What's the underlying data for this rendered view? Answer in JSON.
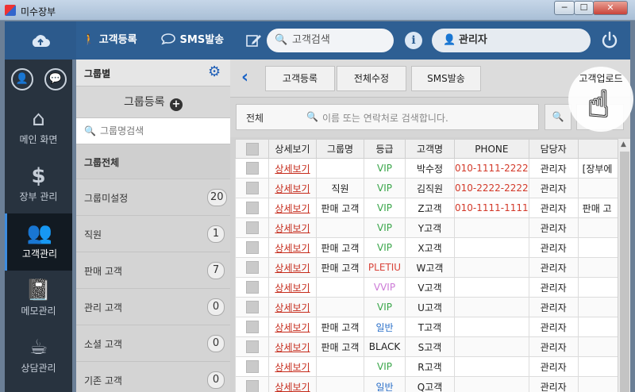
{
  "window": {
    "title": "미수장부",
    "min": "─",
    "max": "☐",
    "close": "✕"
  },
  "topbar": {
    "customer_register": "고객등록",
    "sms_send": "SMS발송",
    "search_placeholder": "고객검색",
    "user_name": "관리자"
  },
  "leftnav": {
    "items": [
      {
        "label": "메인 화면",
        "icon": "home-icon"
      },
      {
        "label": "장부 관리",
        "icon": "dollar-icon"
      },
      {
        "label": "고객관리",
        "icon": "users-icon"
      },
      {
        "label": "메모관리",
        "icon": "book-icon"
      },
      {
        "label": "상담관리",
        "icon": "coffee-icon"
      }
    ]
  },
  "groups": {
    "header": "그룹별",
    "register": "그룹등록",
    "search_placeholder": "그룹명검색",
    "all": "그룹전체",
    "items": [
      {
        "name": "그룹미설정",
        "count": "20"
      },
      {
        "name": "직원",
        "count": "1"
      },
      {
        "name": "판매 고객",
        "count": "7"
      },
      {
        "name": "관리 고객",
        "count": "0"
      },
      {
        "name": "소셜 고객",
        "count": "0"
      },
      {
        "name": "기존 고객",
        "count": "0"
      }
    ]
  },
  "toolbar": {
    "customer_register": "고객등록",
    "edit_all": "전체수정",
    "sms_send": "SMS발송",
    "customer_upload": "고객업로드"
  },
  "search": {
    "scope": "전체",
    "placeholder": "이름 또는 연락처로 검색합니다."
  },
  "table": {
    "headers": [
      "",
      "상세보기",
      "그룹명",
      "등급",
      "고객명",
      "PHONE",
      "담당자",
      ""
    ],
    "rows": [
      {
        "detail": "상세보기",
        "group": "",
        "grade": "VIP",
        "grade_color": "#3aa64a",
        "name": "박수정",
        "phone": "010-1111-2222",
        "manager": "관리자",
        "memo": "[장부에"
      },
      {
        "detail": "상세보기",
        "group": "직원",
        "grade": "VIP",
        "grade_color": "#3aa64a",
        "name": "김직원",
        "phone": "010-2222-2222",
        "manager": "관리자",
        "memo": ""
      },
      {
        "detail": "상세보기",
        "group": "판매 고객",
        "grade": "VIP",
        "grade_color": "#3aa64a",
        "name": "Z고객",
        "phone": "010-1111-1111",
        "manager": "관리자",
        "memo": "판매 고"
      },
      {
        "detail": "상세보기",
        "group": "",
        "grade": "VIP",
        "grade_color": "#3aa64a",
        "name": "Y고객",
        "phone": "",
        "manager": "관리자",
        "memo": ""
      },
      {
        "detail": "상세보기",
        "group": "판매 고객",
        "grade": "VIP",
        "grade_color": "#3aa64a",
        "name": "X고객",
        "phone": "",
        "manager": "관리자",
        "memo": ""
      },
      {
        "detail": "상세보기",
        "group": "판매 고객",
        "grade": "PLETIU",
        "grade_color": "#d9443a",
        "name": "W고객",
        "phone": "",
        "manager": "관리자",
        "memo": ""
      },
      {
        "detail": "상세보기",
        "group": "",
        "grade": "VVIP",
        "grade_color": "#cc7ad6",
        "name": "V고객",
        "phone": "",
        "manager": "관리자",
        "memo": ""
      },
      {
        "detail": "상세보기",
        "group": "",
        "grade": "VIP",
        "grade_color": "#3aa64a",
        "name": "U고객",
        "phone": "",
        "manager": "관리자",
        "memo": ""
      },
      {
        "detail": "상세보기",
        "group": "판매 고객",
        "grade": "일반",
        "grade_color": "#2a6fc9",
        "name": "T고객",
        "phone": "",
        "manager": "관리자",
        "memo": ""
      },
      {
        "detail": "상세보기",
        "group": "판매 고객",
        "grade": "BLACK",
        "grade_color": "#222222",
        "name": "S고객",
        "phone": "",
        "manager": "관리자",
        "memo": ""
      },
      {
        "detail": "상세보기",
        "group": "",
        "grade": "VIP",
        "grade_color": "#3aa64a",
        "name": "R고객",
        "phone": "",
        "manager": "관리자",
        "memo": ""
      },
      {
        "detail": "상세보기",
        "group": "",
        "grade": "일반",
        "grade_color": "#2a6fc9",
        "name": "Q고객",
        "phone": "",
        "manager": "관리자",
        "memo": ""
      }
    ]
  },
  "colors": {
    "topbar": "#2e5f93",
    "nav": "#28333f",
    "nav_active": "#121a22",
    "accent": "#1a63c6"
  }
}
